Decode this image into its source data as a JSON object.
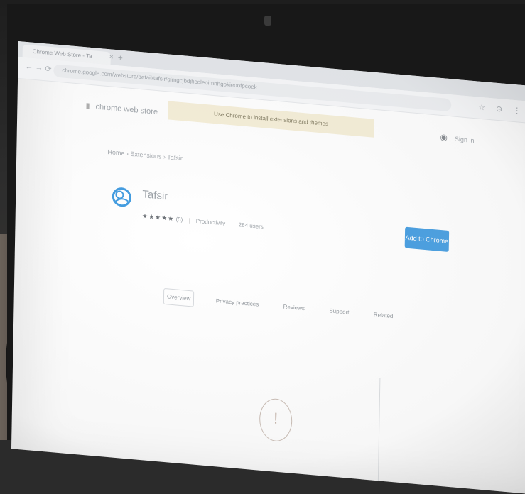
{
  "browser": {
    "tab_title": "Chrome Web Store - Ta",
    "tab_close": "×",
    "new_tab": "+",
    "back": "←",
    "forward": "→",
    "reload": "⟳",
    "url": "chrome.google.com/webstore/detail/tafsir/gimgcjbdjhcoleoimnhgokieoofpcoek",
    "toolbar_icons": "☆ ⊕ ⋮"
  },
  "store": {
    "brand": "chrome web store",
    "notice": "Use Chrome to install extensions and themes",
    "account_label": "Sign in"
  },
  "breadcrumb": "Home › Extensions › Tafsir",
  "extension": {
    "title": "Tafsir",
    "stars": "★★★★★",
    "rating_count": "(5)",
    "category": "Productivity",
    "users": "284 users",
    "install_label": "Add to Chrome"
  },
  "tabs": [
    {
      "label": "Overview"
    },
    {
      "label": "Privacy practices"
    },
    {
      "label": "Reviews"
    },
    {
      "label": "Support"
    },
    {
      "label": "Related"
    }
  ],
  "colors": {
    "accent": "#3e9ae0",
    "notice_bg": "#f5eed6"
  },
  "icons": {
    "warning": "!",
    "account": "account-icon"
  }
}
